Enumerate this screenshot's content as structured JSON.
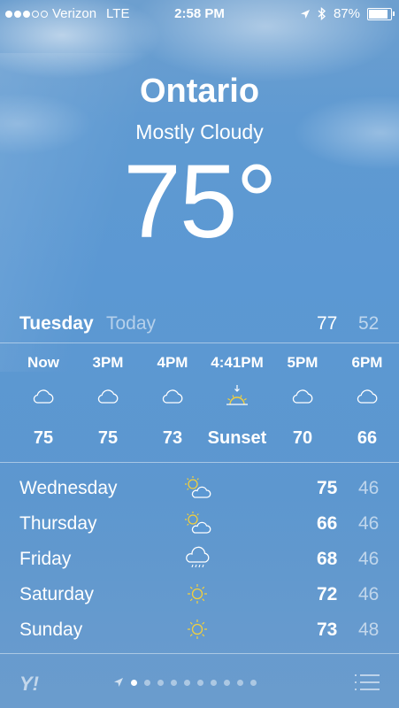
{
  "status_bar": {
    "carrier": "Verizon",
    "network": "LTE",
    "time": "2:58 PM",
    "battery": "87%",
    "battery_level": 0.87,
    "signal_bars_filled": 3,
    "signal_bars_total": 5
  },
  "location": {
    "city": "Ontario",
    "condition": "Mostly Cloudy",
    "temperature": "75°"
  },
  "today": {
    "day": "Tuesday",
    "label": "Today",
    "high": "77",
    "low": "52"
  },
  "hourly": [
    {
      "time": "Now",
      "icon": "cloud-icon",
      "value": "75"
    },
    {
      "time": "3PM",
      "icon": "cloud-icon",
      "value": "75"
    },
    {
      "time": "4PM",
      "icon": "cloud-icon",
      "value": "73"
    },
    {
      "time": "4:41PM",
      "icon": "sunset-icon",
      "value": "Sunset"
    },
    {
      "time": "5PM",
      "icon": "cloud-icon",
      "value": "70"
    },
    {
      "time": "6PM",
      "icon": "cloud-icon",
      "value": "66"
    }
  ],
  "daily": [
    {
      "day": "Wednesday",
      "icon": "partly-cloudy-icon",
      "high": "75",
      "low": "46"
    },
    {
      "day": "Thursday",
      "icon": "partly-cloudy-icon",
      "high": "66",
      "low": "46"
    },
    {
      "day": "Friday",
      "icon": "rain-cloud-icon",
      "high": "68",
      "low": "46"
    },
    {
      "day": "Saturday",
      "icon": "sun-icon",
      "high": "72",
      "low": "46"
    },
    {
      "day": "Sunday",
      "icon": "sun-icon",
      "high": "73",
      "low": "48"
    }
  ],
  "footer": {
    "provider": "Y!",
    "page_count": 11,
    "current_page": 2
  },
  "colors": {
    "sky": "#5b98d3",
    "sun": "#f3d03c"
  }
}
